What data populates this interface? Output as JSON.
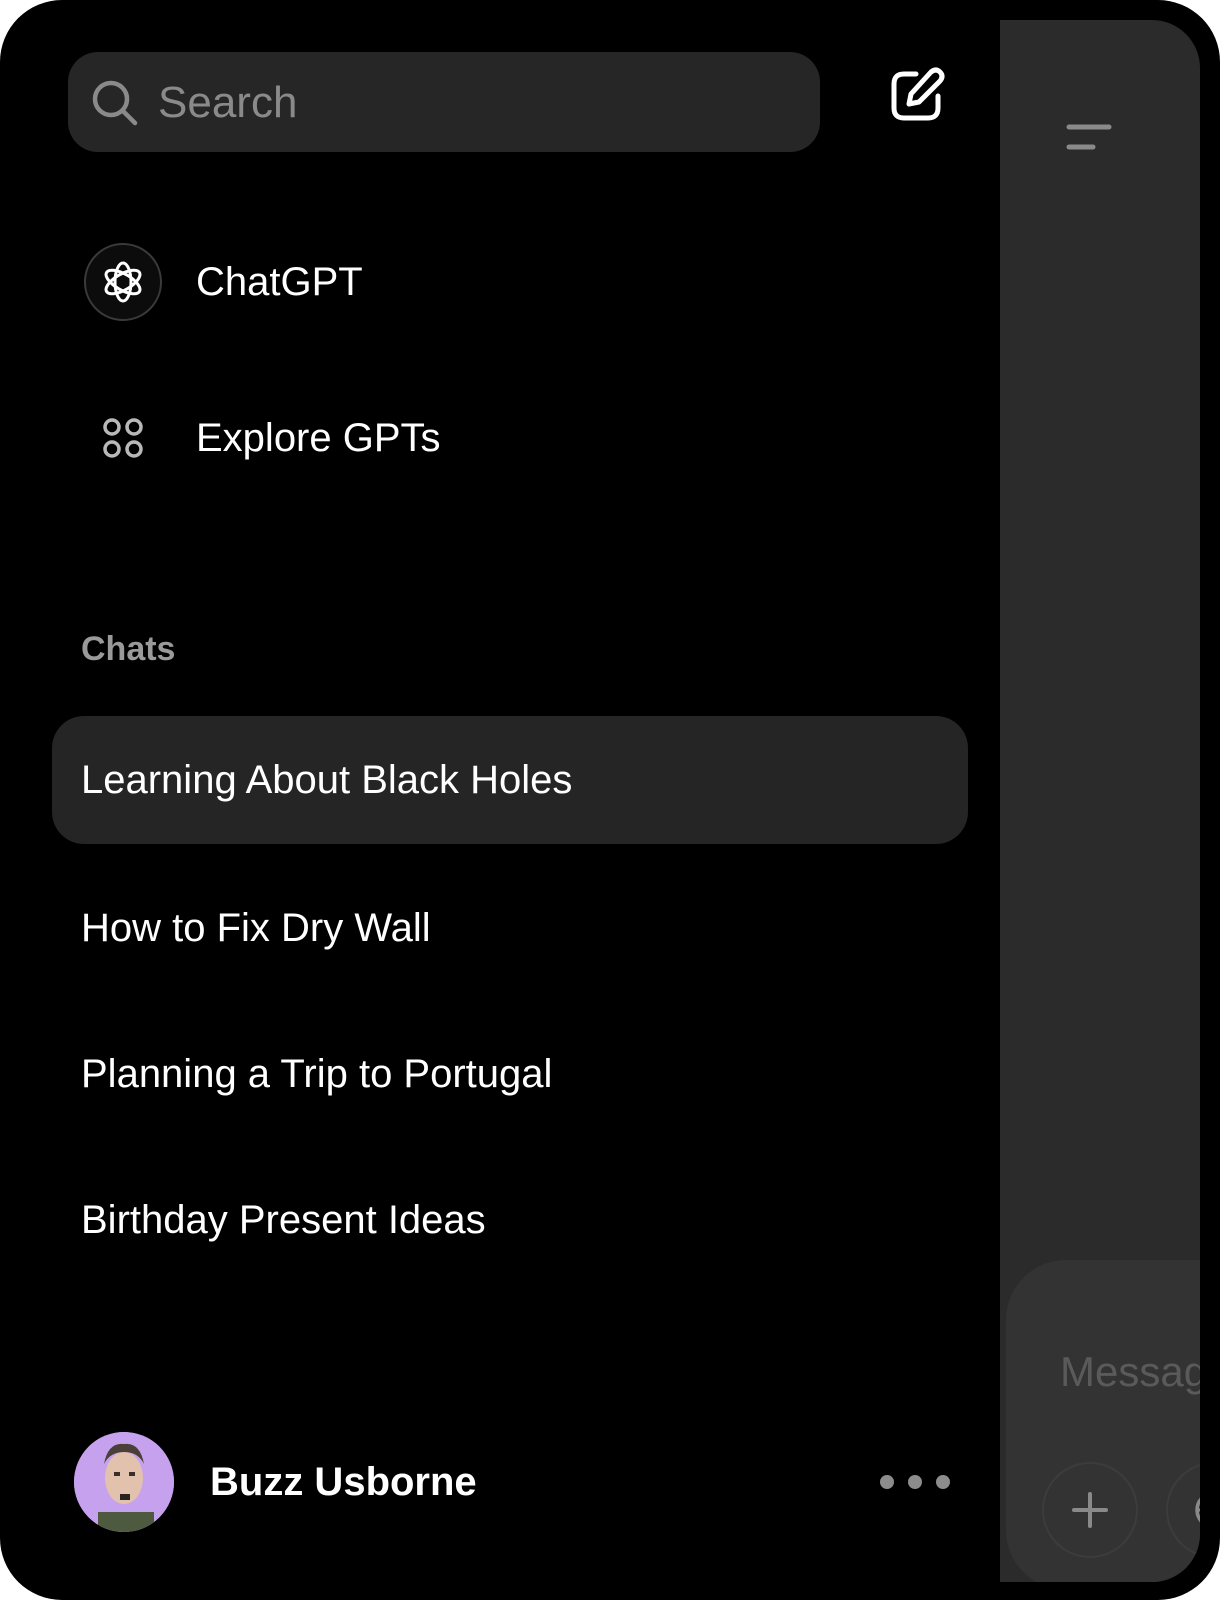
{
  "sidebar": {
    "search": {
      "placeholder": "Search"
    },
    "nav": [
      {
        "label": "ChatGPT",
        "icon": "chatgpt-logo-icon"
      },
      {
        "label": "Explore GPTs",
        "icon": "grid-dots-icon"
      }
    ],
    "section_title": "Chats",
    "chats": [
      {
        "title": "Learning About Black Holes",
        "active": true
      },
      {
        "title": "How to Fix Dry Wall",
        "active": false
      },
      {
        "title": "Planning a Trip to Portugal",
        "active": false
      },
      {
        "title": "Birthday Present Ideas",
        "active": false
      }
    ],
    "profile": {
      "name": "Buzz Usborne",
      "more_icon": "more-dots-icon"
    }
  },
  "main": {
    "composer": {
      "placeholder": "Message"
    },
    "icons": [
      "menu-icon",
      "plus-icon",
      "globe-icon"
    ]
  },
  "colors": {
    "background": "#000000",
    "surface": "#262626",
    "panel": "#2b2b2b",
    "text": "#ffffff",
    "muted": "#9a9a9a",
    "avatar_bg": "#c6a1ee"
  }
}
